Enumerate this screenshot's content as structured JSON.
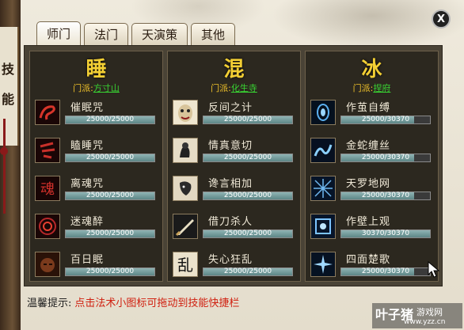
{
  "tabs": [
    {
      "label": "师门",
      "active": true
    },
    {
      "label": "法门",
      "active": false
    },
    {
      "label": "天演策",
      "active": false
    },
    {
      "label": "其他",
      "active": false
    }
  ],
  "close_label": "X",
  "scroll_chars": [
    "技",
    "能"
  ],
  "columns": [
    {
      "title": "睡",
      "school_label": "门派:",
      "school_value": "方寸山",
      "skills": [
        {
          "name": "催眠咒",
          "progress": "25000/25000",
          "fill": 1.0,
          "icon": "red-swirl-icon"
        },
        {
          "name": "瞌睡咒",
          "progress": "25000/25000",
          "fill": 1.0,
          "icon": "red-symbol-icon"
        },
        {
          "name": "离魂咒",
          "progress": "25000/25000",
          "fill": 1.0,
          "icon": "red-soul-glyph-icon"
        },
        {
          "name": "迷魂醉",
          "progress": "25000/25000",
          "fill": 1.0,
          "icon": "red-spiral-icon"
        },
        {
          "name": "百日眠",
          "progress": "25000/25000",
          "fill": 1.0,
          "icon": "sleeping-face-icon"
        }
      ]
    },
    {
      "title": "混",
      "school_label": "门派:",
      "school_value": "化生寺",
      "skills": [
        {
          "name": "反间之计",
          "progress": "25000/25000",
          "fill": 1.0,
          "icon": "mask-face-icon"
        },
        {
          "name": "情真意切",
          "progress": "25000/25000",
          "fill": 1.0,
          "icon": "ink-figure-icon"
        },
        {
          "name": "谗言相加",
          "progress": "25000/25000",
          "fill": 1.0,
          "icon": "ink-face-icon"
        },
        {
          "name": "借刀杀人",
          "progress": "25000/25000",
          "fill": 1.0,
          "icon": "blade-icon"
        },
        {
          "name": "失心狂乱",
          "progress": "25000/25000",
          "fill": 1.0,
          "icon": "chaos-glyph-icon"
        }
      ]
    },
    {
      "title": "冰",
      "school_label": "门派:",
      "school_value": "捏府",
      "skills": [
        {
          "name": "作茧自缚",
          "progress": "25000/30370",
          "fill": 0.823,
          "icon": "blue-cocoon-icon"
        },
        {
          "name": "金蛇缠丝",
          "progress": "25000/30370",
          "fill": 0.823,
          "icon": "blue-snake-icon"
        },
        {
          "name": "天罗地网",
          "progress": "25000/30370",
          "fill": 0.823,
          "icon": "blue-net-icon"
        },
        {
          "name": "作壁上观",
          "progress": "30370/30370",
          "fill": 1.0,
          "icon": "blue-wall-icon"
        },
        {
          "name": "四面楚歌",
          "progress": "25000/30370",
          "fill": 0.823,
          "icon": "blue-burst-icon"
        }
      ]
    }
  ],
  "tip": {
    "label": "温馨提示:",
    "text": "点击法术小图标可拖动到技能快捷栏"
  },
  "watermark": {
    "brand": "叶子猪",
    "game": "游戏网",
    "url": "www.yzz.cn"
  },
  "colors": {
    "title_gold": "#f3cf34",
    "school_green": "#39d533",
    "tip_red": "#d02010",
    "panel_bg": "#2c281f"
  }
}
